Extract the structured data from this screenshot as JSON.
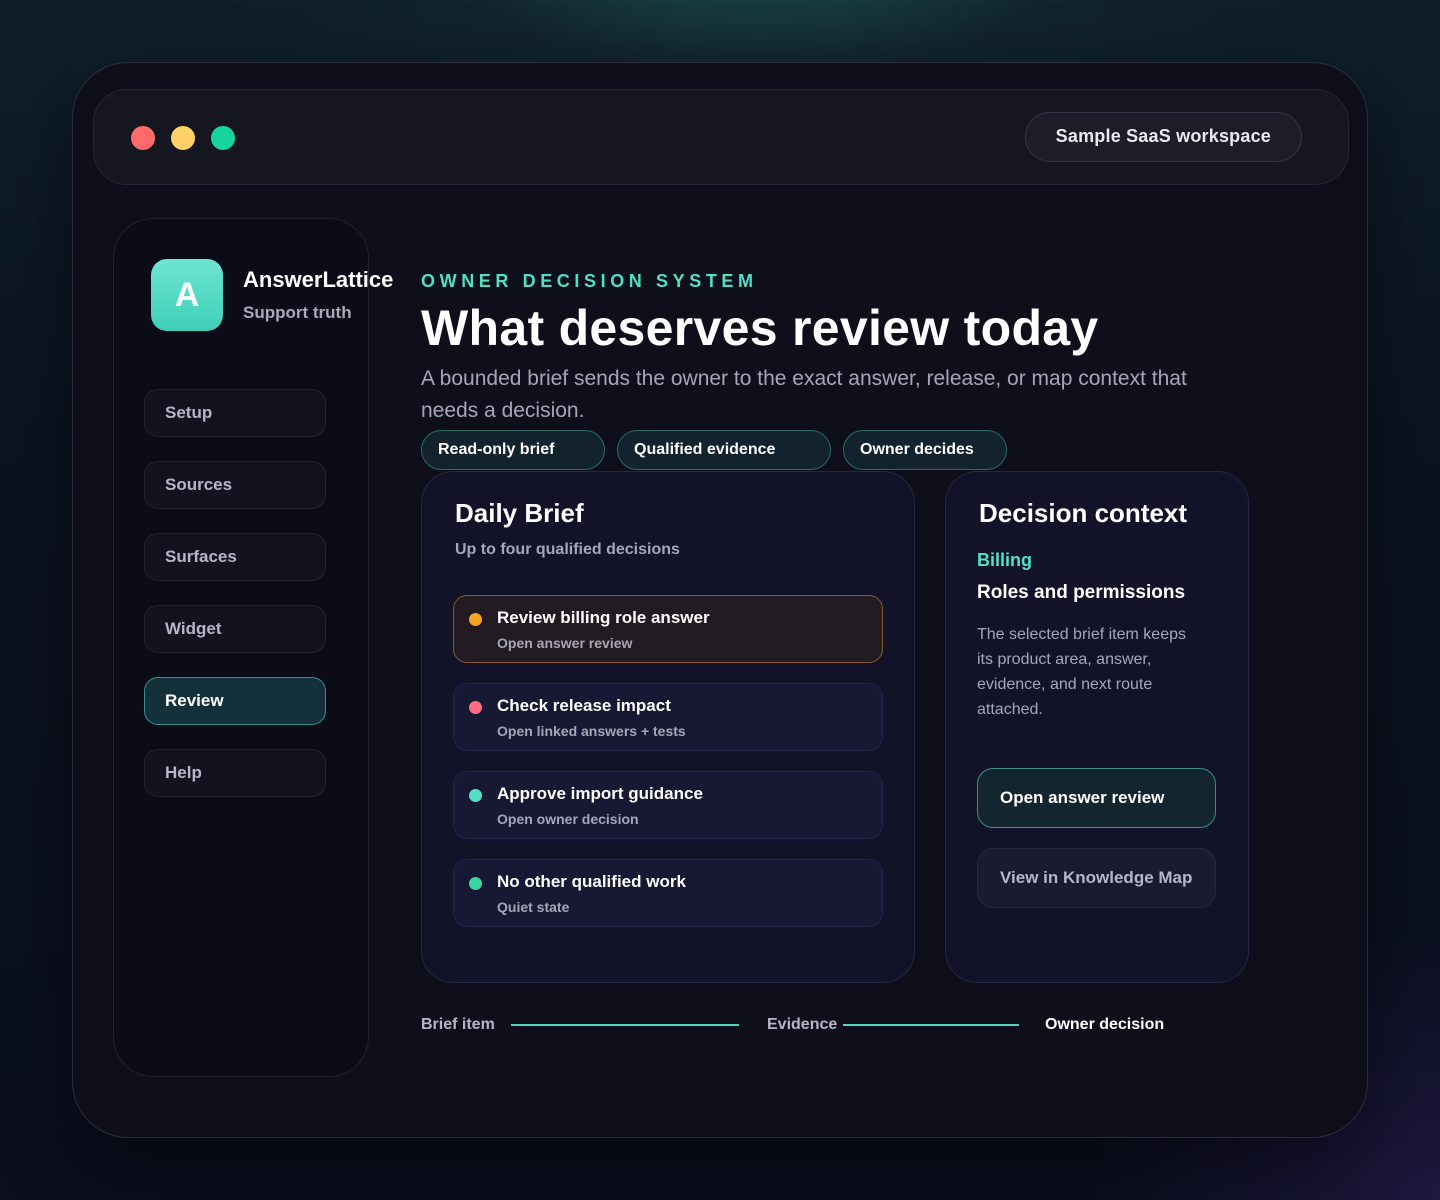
{
  "window": {
    "traffic_lights": [
      "close",
      "minimize",
      "maximize"
    ],
    "workspace_label": "Sample SaaS workspace"
  },
  "sidebar": {
    "logo_letter": "A",
    "brand_name": "AnswerLattice",
    "brand_subtitle": "Support truth",
    "items": [
      {
        "label": "Setup",
        "active": false
      },
      {
        "label": "Sources",
        "active": false
      },
      {
        "label": "Surfaces",
        "active": false
      },
      {
        "label": "Widget",
        "active": false
      },
      {
        "label": "Review",
        "active": true
      },
      {
        "label": "Help",
        "active": false
      }
    ]
  },
  "header": {
    "eyebrow": "OWNER DECISION SYSTEM",
    "title": "What deserves review today",
    "subtitle": "A bounded brief sends the owner to the exact answer, release, or map context that needs a decision.",
    "chips": [
      "Read-only brief",
      "Qualified evidence",
      "Owner decides"
    ]
  },
  "daily_brief": {
    "title": "Daily Brief",
    "subtitle": "Up to four qualified decisions",
    "items": [
      {
        "title": "Review billing role answer",
        "meta": "Open answer review",
        "dot_color": "#f5a524",
        "selected": true
      },
      {
        "title": "Check release impact",
        "meta": "Open linked answers + tests",
        "dot_color": "#ff6b81",
        "selected": false
      },
      {
        "title": "Approve import guidance",
        "meta": "Open owner decision",
        "dot_color": "#4fe0c6",
        "selected": false
      },
      {
        "title": "No other qualified work",
        "meta": "Quiet state",
        "dot_color": "#3dd6a0",
        "selected": false
      }
    ]
  },
  "decision_context": {
    "title": "Decision context",
    "area": "Billing",
    "topic": "Roles and permissions",
    "description": "The selected brief item keeps its product area, answer, evidence, and next route attached.",
    "primary_button": "Open answer review",
    "secondary_button": "View in Knowledge Map"
  },
  "flow": {
    "steps": [
      "Brief item",
      "Evidence",
      "Owner decision"
    ]
  },
  "colors": {
    "accent": "#4fe0c6",
    "background": "#0e0f1b",
    "selected_border": "#8a5a2a"
  }
}
